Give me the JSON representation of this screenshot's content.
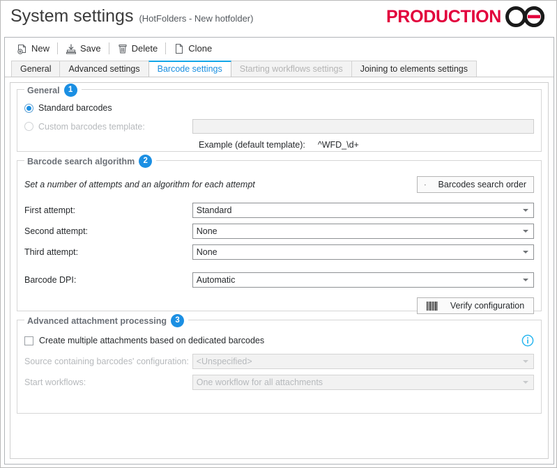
{
  "header": {
    "title": "System settings",
    "subtitle": "(HotFolders - New hotfolder)",
    "logo_text": "PRODUCTION",
    "logo_color": "#e2003c",
    "logo_mark_color": "#1a1a1a"
  },
  "toolbar": {
    "items": [
      {
        "label": "New",
        "icon": "new-document-icon"
      },
      {
        "label": "Save",
        "icon": "save-icon"
      },
      {
        "label": "Delete",
        "icon": "trash-icon"
      },
      {
        "label": "Clone",
        "icon": "clone-icon"
      }
    ]
  },
  "tabs": [
    {
      "label": "General",
      "state": "normal"
    },
    {
      "label": "Advanced settings",
      "state": "normal"
    },
    {
      "label": "Barcode settings",
      "state": "active"
    },
    {
      "label": "Starting workflows settings",
      "state": "disabled"
    },
    {
      "label": "Joining to elements settings",
      "state": "normal"
    }
  ],
  "accent_color": "#1b8fe3",
  "groups": {
    "general": {
      "legend": "General",
      "badge": "1",
      "radio_standard": {
        "label": "Standard barcodes",
        "checked": true,
        "disabled": false
      },
      "radio_custom": {
        "label": "Custom barcodes template:",
        "checked": false,
        "disabled": true
      },
      "template_value": "",
      "example_label": "Example (default template):",
      "example_value": "^WFD_\\d+"
    },
    "search_algorithm": {
      "legend": "Barcode search algorithm",
      "badge": "2",
      "hint": "Set a number of attempts and an algorithm for each attempt",
      "search_order_button": {
        "label": "Barcodes search order",
        "icon": "barcode-icon"
      },
      "verify_button": {
        "label": "Verify configuration",
        "icon": "barcode-icon"
      },
      "fields": [
        {
          "label": "First attempt:",
          "value": "Standard"
        },
        {
          "label": "Second attempt:",
          "value": "None"
        },
        {
          "label": "Third attempt:",
          "value": "None"
        }
      ],
      "dpi_field": {
        "label": "Barcode DPI:",
        "value": "Automatic"
      }
    },
    "advanced_attachment": {
      "legend": "Advanced attachment processing",
      "badge": "3",
      "checkbox": {
        "label": "Create multiple attachments based on dedicated barcodes",
        "checked": false
      },
      "info_icon": "info-icon",
      "fields": [
        {
          "label": "Source containing barcodes' configuration:",
          "value": "<Unspecified>",
          "disabled": true
        },
        {
          "label": "Start workflows:",
          "value": "One workflow for all attachments",
          "disabled": true
        }
      ]
    }
  }
}
